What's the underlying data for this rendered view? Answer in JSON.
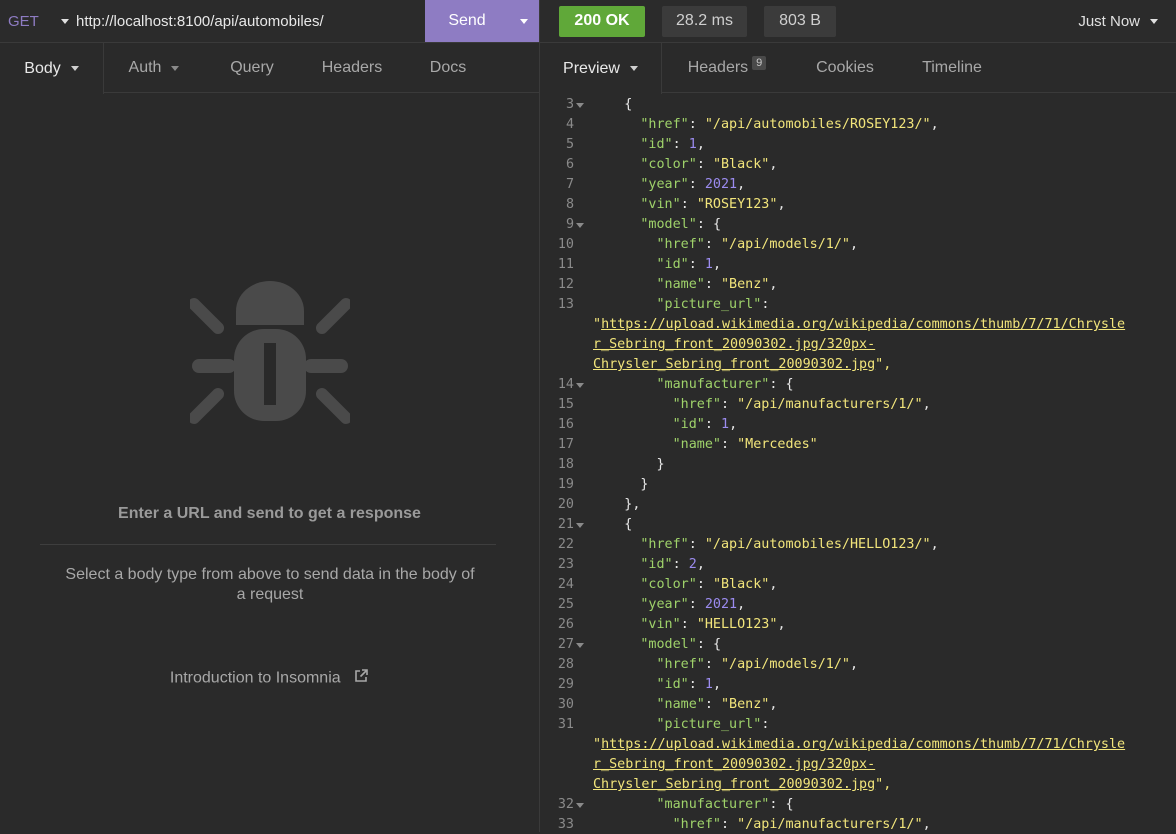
{
  "request": {
    "method": "GET",
    "url": "http://localhost:8100/api/automobiles/",
    "send_label": "Send"
  },
  "response": {
    "status": "200 OK",
    "time": "28.2 ms",
    "size": "803 B",
    "history": "Just Now"
  },
  "request_tabs": {
    "body": "Body",
    "auth": "Auth",
    "query": "Query",
    "headers": "Headers",
    "docs": "Docs"
  },
  "response_tabs": {
    "preview": "Preview",
    "headers": "Headers",
    "headers_count": "9",
    "cookies": "Cookies",
    "timeline": "Timeline"
  },
  "empty_state": {
    "title": "Enter a URL and send to get a response",
    "description": "Select a body type from above to send data in the body of a request",
    "link": "Introduction to Insomnia"
  },
  "colors": {
    "accent": "#8e7cc3",
    "status_ok": "#60a839",
    "key": "#9fd26a",
    "string": "#f2e57b",
    "number": "#9c8cf0"
  },
  "icons": {
    "empty_state": "bug-icon",
    "link": "external-link-icon"
  },
  "code_lines": [
    {
      "n": "3",
      "fold": true,
      "text": "    {"
    },
    {
      "n": "4",
      "text": "      \"href\": \"/api/automobiles/ROSEY123/\","
    },
    {
      "n": "5",
      "text": "      \"id\": 1,"
    },
    {
      "n": "6",
      "text": "      \"color\": \"Black\","
    },
    {
      "n": "7",
      "text": "      \"year\": 2021,"
    },
    {
      "n": "8",
      "text": "      \"vin\": \"ROSEY123\","
    },
    {
      "n": "9",
      "fold": true,
      "text": "      \"model\": {"
    },
    {
      "n": "10",
      "text": "        \"href\": \"/api/models/1/\","
    },
    {
      "n": "11",
      "text": "        \"id\": 1,"
    },
    {
      "n": "12",
      "text": "        \"name\": \"Benz\","
    },
    {
      "n": "13",
      "text": "        \"picture_url\":"
    },
    {
      "n": "",
      "text": "\"https://upload.wikimedia.org/wikipedia/commons/thumb/7/71/Chrysle"
    },
    {
      "n": "",
      "text": "r_Sebring_front_20090302.jpg/320px-"
    },
    {
      "n": "",
      "text": "Chrysler_Sebring_front_20090302.jpg\","
    },
    {
      "n": "14",
      "fold": true,
      "text": "        \"manufacturer\": {"
    },
    {
      "n": "15",
      "text": "          \"href\": \"/api/manufacturers/1/\","
    },
    {
      "n": "16",
      "text": "          \"id\": 1,"
    },
    {
      "n": "17",
      "text": "          \"name\": \"Mercedes\""
    },
    {
      "n": "18",
      "text": "        }"
    },
    {
      "n": "19",
      "text": "      }"
    },
    {
      "n": "20",
      "text": "    },"
    },
    {
      "n": "21",
      "fold": true,
      "text": "    {"
    },
    {
      "n": "22",
      "text": "      \"href\": \"/api/automobiles/HELLO123/\","
    },
    {
      "n": "23",
      "text": "      \"id\": 2,"
    },
    {
      "n": "24",
      "text": "      \"color\": \"Black\","
    },
    {
      "n": "25",
      "text": "      \"year\": 2021,"
    },
    {
      "n": "26",
      "text": "      \"vin\": \"HELLO123\","
    },
    {
      "n": "27",
      "fold": true,
      "text": "      \"model\": {"
    },
    {
      "n": "28",
      "text": "        \"href\": \"/api/models/1/\","
    },
    {
      "n": "29",
      "text": "        \"id\": 1,"
    },
    {
      "n": "30",
      "text": "        \"name\": \"Benz\","
    },
    {
      "n": "31",
      "text": "        \"picture_url\":"
    },
    {
      "n": "",
      "text": "\"https://upload.wikimedia.org/wikipedia/commons/thumb/7/71/Chrysle"
    },
    {
      "n": "",
      "text": "r_Sebring_front_20090302.jpg/320px-"
    },
    {
      "n": "",
      "text": "Chrysler_Sebring_front_20090302.jpg\","
    },
    {
      "n": "32",
      "fold": true,
      "text": "        \"manufacturer\": {"
    },
    {
      "n": "33",
      "text": "          \"href\": \"/api/manufacturers/1/\","
    }
  ]
}
